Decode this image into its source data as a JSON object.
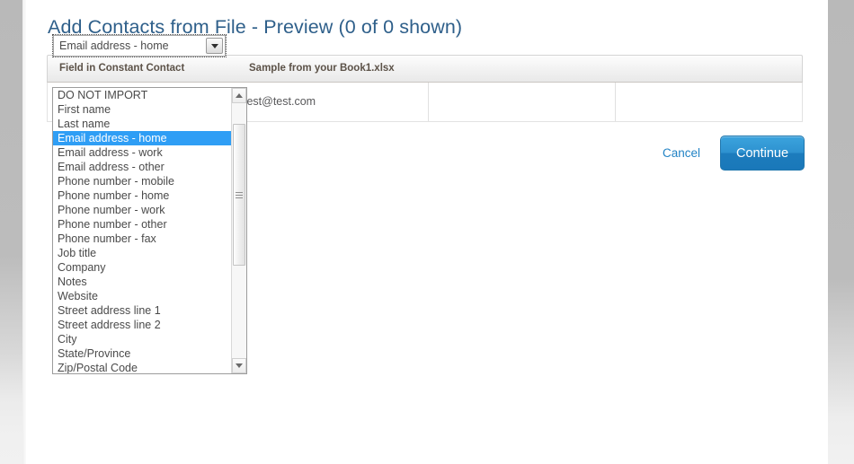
{
  "header": {
    "title": "Add Contacts from File - Preview (0 of 0 shown)"
  },
  "table": {
    "columns": [
      "Field in Constant Contact",
      "Sample from your Book1.xlsx"
    ],
    "row": {
      "selected_field": "Email address - home",
      "sample_value": "test@test.com"
    }
  },
  "dropdown": {
    "selected": "Email address - home",
    "options": [
      "DO NOT IMPORT",
      "First name",
      "Last name",
      "Email address - home",
      "Email address - work",
      "Email address - other",
      "Phone number - mobile",
      "Phone number - home",
      "Phone number - work",
      "Phone number - other",
      "Phone number - fax",
      "Job title",
      "Company",
      "Notes",
      "Website",
      "Street address line 1",
      "Street address line 2",
      "City",
      "State/Province",
      "Zip/Postal Code"
    ],
    "scroll_up_icon": "triangle-up-icon",
    "scroll_down_icon": "triangle-down-icon",
    "arrow_icon": "chevron-down-icon"
  },
  "actions": {
    "cancel_label": "Cancel",
    "continue_label": "Continue"
  },
  "colors": {
    "title": "#2e5f8a",
    "highlight": "#2f9ef5",
    "link": "#2283c5",
    "primary_button": "#2e92d0"
  }
}
